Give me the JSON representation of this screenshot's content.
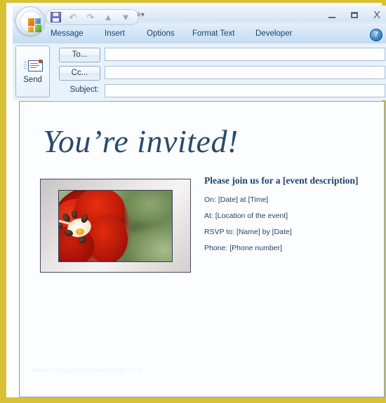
{
  "window": {
    "office_button": "office-orb",
    "quick_access": [
      {
        "name": "save",
        "icon": "save-icon",
        "label": "Save"
      },
      {
        "name": "undo",
        "icon": "undo-icon",
        "label": "Undo"
      },
      {
        "name": "redo",
        "icon": "redo-icon",
        "label": "Redo"
      },
      {
        "name": "previous-item",
        "icon": "up-arrow-icon",
        "label": "Previous Item"
      },
      {
        "name": "next-item",
        "icon": "down-arrow-icon",
        "label": "Next Item"
      },
      {
        "name": "customize",
        "icon": "chevron-down-icon",
        "label": "Customize Quick Access Toolbar"
      }
    ],
    "controls": {
      "minimize": "Minimize",
      "maximize": "Maximize",
      "close": "X"
    },
    "accent_gold": "#d9c136",
    "accent_blue": "#16446e"
  },
  "ribbon": {
    "tabs": [
      {
        "label": "Message",
        "active": true
      },
      {
        "label": "Insert",
        "active": false
      },
      {
        "label": "Options",
        "active": false
      },
      {
        "label": "Format Text",
        "active": false
      },
      {
        "label": "Developer",
        "active": false
      }
    ],
    "help": "?"
  },
  "compose": {
    "send_label": "Send",
    "to_label": "To...",
    "cc_label": "Cc...",
    "subject_label": "Subject:",
    "to_value": "",
    "cc_value": "",
    "subject_value": "",
    "to_placeholder": "",
    "cc_placeholder": "",
    "subject_placeholder": ""
  },
  "body": {
    "title": "You’re invited!",
    "image_alt": "Red tulip flower close-up in a beveled gray picture frame",
    "event": {
      "heading": "Please join us for a [event description]",
      "lines": [
        "On:   [Date] at [Time]",
        "At:  [Location of the event]",
        "RSVP to:  [Name] by [Date]",
        "Phone:  [Phone number]"
      ]
    },
    "watermark": "www.heritagechristiancollege.com"
  }
}
